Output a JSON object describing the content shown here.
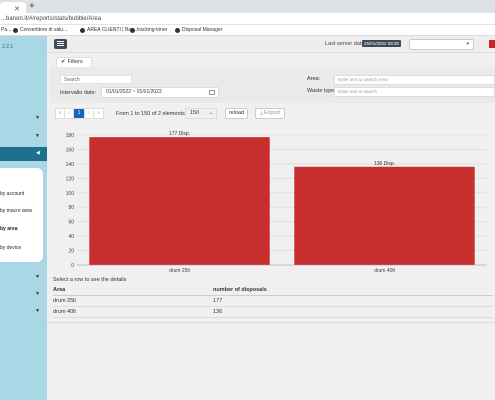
{
  "browser": {
    "url": "...banon.it/#/reports/stats/bubble/Area",
    "bookmarks": [
      "Pa...",
      "Convertitore di valu...",
      "AREA CLIENTI | Bav...",
      "tracking-timer",
      "Disposal Manager"
    ]
  },
  "sidebar": {
    "version": "2.2.1",
    "submenu": [
      {
        "label": "by account",
        "active": false
      },
      {
        "label": "by macro area",
        "active": false
      },
      {
        "label": "by area",
        "active": true
      },
      {
        "label": "by device",
        "active": false
      }
    ]
  },
  "topbar": {
    "last_server_data_label": "Last server data:",
    "last_server_data_value": "25/01/2022 09:30"
  },
  "filters": {
    "tab_label": "Filters",
    "search_placeholder": "Search",
    "date_label": "Intervallo date:",
    "date_value": "01/01/2022 ~ 01/01/2022",
    "area_label": "Area:",
    "area_placeholder": "Enter text to search Area",
    "waste_label": "Waste type:",
    "waste_placeholder": "Enter text to search"
  },
  "pagination": {
    "first": "«",
    "prev": "‹",
    "current": "1",
    "next": "›",
    "last": "»",
    "range_text": "From 1 to 150 of 2 elements",
    "page_size": "150",
    "reload_label": "reload",
    "export_label": "Export"
  },
  "chart_data": {
    "type": "bar",
    "categories": [
      "drum 25lt",
      "drum 40lt"
    ],
    "values": [
      177,
      136
    ],
    "data_labels": [
      "177 Disp.",
      "136 Disp."
    ],
    "ylim": [
      0,
      180
    ],
    "yticks": [
      0,
      20,
      40,
      60,
      80,
      100,
      120,
      140,
      160,
      180
    ],
    "bar_color": "#c62f2d",
    "grid": true
  },
  "details": {
    "hint": "Select a row to see the details",
    "columns": [
      "Area",
      "number of disposals"
    ],
    "rows": [
      [
        "drum 25lt",
        "177"
      ],
      [
        "drum 40lt",
        "136"
      ]
    ]
  },
  "colors": {
    "sidebar": "#aad7e5",
    "sidebar_active": "#1e6f8f",
    "primary": "#1565c0",
    "dark": "#3c4b59"
  }
}
